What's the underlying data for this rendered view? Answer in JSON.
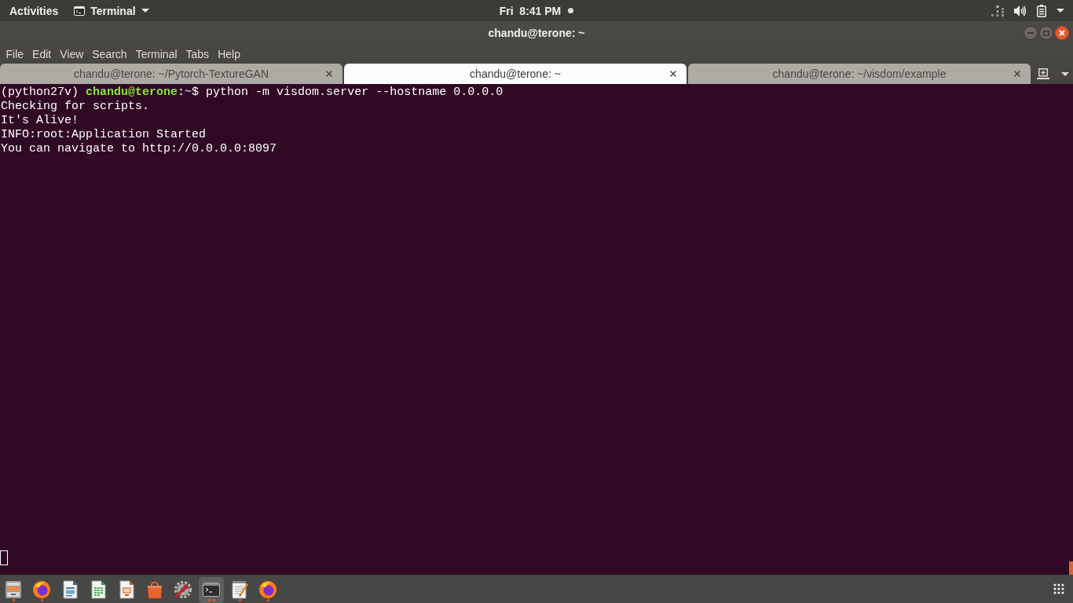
{
  "top_bar": {
    "activities": "Activities",
    "app_menu": "Terminal",
    "clock": "Fri  8:41 PM",
    "notification_dot": true
  },
  "window": {
    "title": "chandu@terone: ~",
    "menu": [
      "File",
      "Edit",
      "View",
      "Search",
      "Terminal",
      "Tabs",
      "Help"
    ],
    "tabs": [
      {
        "label": "chandu@terone: ~/Pytorch-TextureGAN",
        "selected": false
      },
      {
        "label": "chandu@terone: ~",
        "selected": true
      },
      {
        "label": "chandu@terone: ~/visdom/example",
        "selected": false
      }
    ],
    "terminal": {
      "lines": [
        {
          "segments": [
            {
              "kind": "plain",
              "text": "(python27v) "
            },
            {
              "kind": "user_host",
              "text": "chandu@terone"
            },
            {
              "kind": "plain",
              "text": ":"
            },
            {
              "kind": "path",
              "text": "~"
            },
            {
              "kind": "plain",
              "text": "$ python -m visdom.server --hostname 0.0.0.0"
            }
          ]
        },
        {
          "segments": [
            {
              "kind": "plain",
              "text": "Checking for scripts."
            }
          ]
        },
        {
          "segments": [
            {
              "kind": "plain",
              "text": "It's Alive!"
            }
          ]
        },
        {
          "segments": [
            {
              "kind": "plain",
              "text": "INFO:root:Application Started"
            }
          ]
        },
        {
          "segments": [
            {
              "kind": "plain",
              "text": "You can navigate to http://0.0.0.0:8097"
            }
          ]
        }
      ],
      "cursor_filled": false
    }
  },
  "dock": {
    "items": [
      {
        "kind": "files",
        "running": true,
        "multiple_windows": false,
        "focused": false
      },
      {
        "kind": "browser",
        "running": true,
        "multiple_windows": false,
        "focused": false
      },
      {
        "kind": "writer",
        "running": false,
        "multiple_windows": false,
        "focused": false
      },
      {
        "kind": "calc",
        "running": false,
        "multiple_windows": false,
        "focused": false
      },
      {
        "kind": "impress",
        "running": false,
        "multiple_windows": false,
        "focused": false
      },
      {
        "kind": "software",
        "running": false,
        "multiple_windows": false,
        "focused": false
      },
      {
        "kind": "settings",
        "running": false,
        "multiple_windows": false,
        "focused": false
      },
      {
        "kind": "terminal",
        "running": true,
        "multiple_windows": true,
        "focused": true
      },
      {
        "kind": "editor",
        "running": true,
        "multiple_windows": false,
        "focused": false
      },
      {
        "kind": "browser",
        "running": true,
        "multiple_windows": false,
        "focused": false
      }
    ]
  }
}
